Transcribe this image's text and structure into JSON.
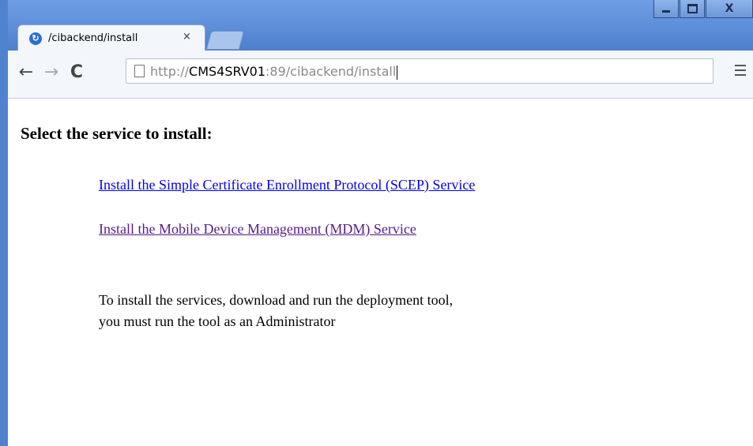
{
  "window": {
    "controls": {
      "minimize": "minimize",
      "maximize": "maximize",
      "close": "X"
    }
  },
  "tab": {
    "title": "/cibackend/install",
    "close_label": "×",
    "favicon": "chrome-logo-icon"
  },
  "toolbar": {
    "back_icon": "←",
    "forward_icon": "→",
    "reload_icon": "C",
    "url_scheme": "http://",
    "url_host": "CMS4SRV01",
    "url_rest": ":89/cibackend/install"
  },
  "page": {
    "heading": "Select the service to install:",
    "links": [
      {
        "label": "Install the Simple Certificate Enrollment Protocol (SCEP) Service",
        "visited": false
      },
      {
        "label": "Install the Mobile Device Management (MDM) Service",
        "visited": true
      }
    ],
    "note_line1": "To install the services, download and run the deployment tool,",
    "note_line2": "you must run the tool as an Administrator"
  },
  "colors": {
    "link": "#0000ee",
    "visited_link": "#551a8b",
    "titlebar": "#5b8cd6"
  }
}
